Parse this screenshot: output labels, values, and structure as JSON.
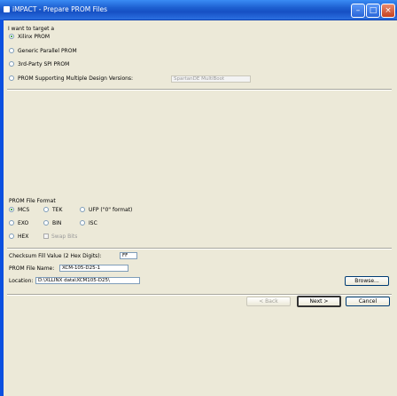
{
  "window": {
    "title": "iMPACT - Prepare PROM Files",
    "minimize_glyph": "–",
    "maximize_glyph": "□",
    "close_glyph": "×"
  },
  "target": {
    "heading": "I want to target a",
    "options": [
      "Xilinx PROM",
      "Generic Parallel PROM",
      "3rd-Party SPI PROM",
      "PROM Supporting Multiple Design Versions:"
    ],
    "selected": 0,
    "design_versions_value": "SpartanDE MultiBoot"
  },
  "format": {
    "heading": "PROM File Format",
    "row1": [
      "MCS",
      "TEK",
      "UFP (\"0\" format)"
    ],
    "row1_selected": 0,
    "row2": [
      "EXO",
      "BIN",
      "ISC"
    ],
    "hex_label": "HEX",
    "swap_bits_label": "Swap Bits"
  },
  "file": {
    "checksum_label": "Checksum Fill Value (2 Hex Digits):",
    "checksum_value": "FF",
    "name_label": "PROM File Name:",
    "name_value": "XCM-105-D25-1",
    "location_label": "Location:",
    "location_value": "D:\\XLLINX data\\XCM105-D25\\",
    "browse_label": "Browse..."
  },
  "nav": {
    "back_label": "< Back",
    "next_label": "Next >",
    "cancel_label": "Cancel"
  }
}
